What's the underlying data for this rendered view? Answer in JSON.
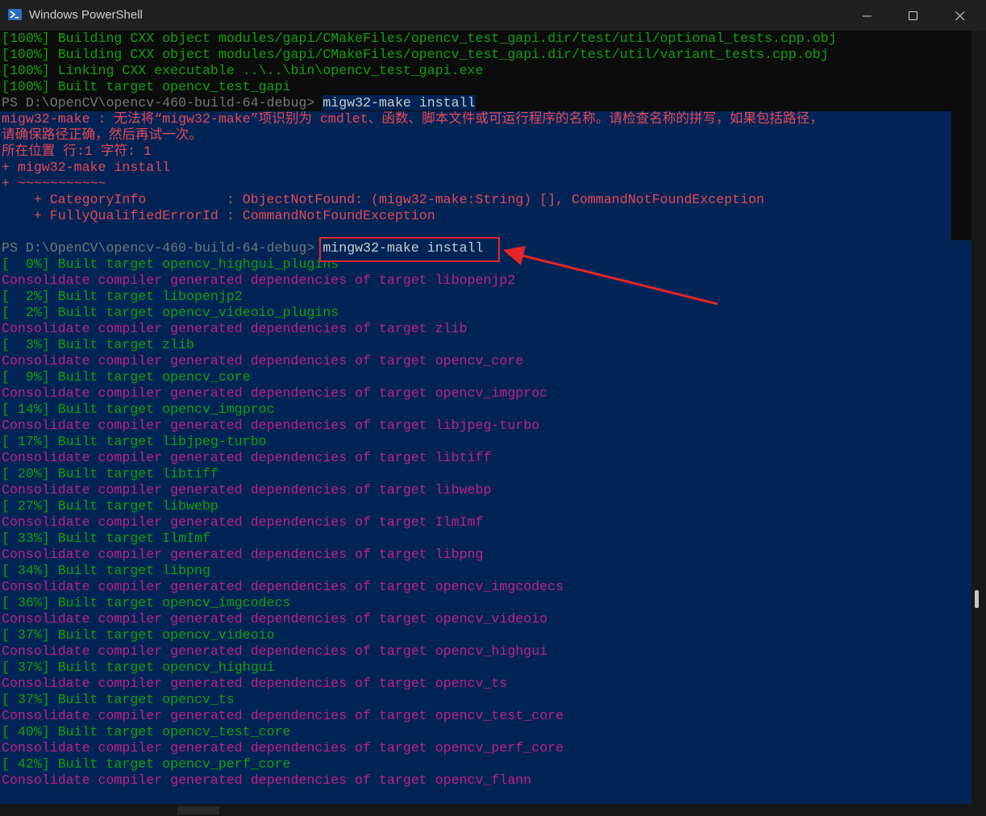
{
  "window": {
    "title": "Windows PowerShell"
  },
  "colors": {
    "selection": "#012456",
    "green": "#13a10e",
    "red": "#e74856",
    "magenta": "#c0208f",
    "annotation": "#e8262a"
  },
  "icons": {
    "app": "powershell-icon",
    "minimize": "minimize-icon",
    "maximize": "maximize-icon",
    "close": "close-icon"
  },
  "lines": [
    {
      "text": "[100%] Building CXX object modules/gapi/CMakeFiles/opencv_test_gapi.dir/test/util/optional_tests.cpp.obj"
    },
    {
      "text": "[100%] Building CXX object modules/gapi/CMakeFiles/opencv_test_gapi.dir/test/util/variant_tests.cpp.obj"
    },
    {
      "text": "[100%] Linking CXX executable ..\\..\\bin\\opencv_test_gapi.exe"
    },
    {
      "text": "[100%] Built target opencv_test_gapi"
    },
    {
      "prompt": "PS D:\\OpenCV\\opencv-460-build-64-debug> ",
      "cmd": "migw32-make install"
    },
    {
      "text": "migw32-make : 无法将“migw32-make”项识别为 cmdlet、函数、脚本文件或可运行程序的名称。请检查名称的拼写，如果包括路径，"
    },
    {
      "text": "请确保路径正确，然后再试一次。"
    },
    {
      "text": "所在位置 行:1 字符: 1"
    },
    {
      "text": "+ migw32-make install"
    },
    {
      "text": "+ ~~~~~~~~~~~"
    },
    {
      "text": "    + CategoryInfo          : ObjectNotFound: (migw32-make:String) [], CommandNotFoundException"
    },
    {
      "text": "    + FullyQualifiedErrorId : CommandNotFoundException"
    },
    {
      "text": ""
    },
    {
      "prompt": "PS D:\\OpenCV\\opencv-460-build-64-debug> ",
      "cmd": "mingw32-make install"
    },
    {
      "text": "[  0%] Built target opencv_highgui_plugins"
    },
    {
      "text": "Consolidate compiler generated dependencies of target libopenjp2"
    },
    {
      "text": "[  2%] Built target libopenjp2"
    },
    {
      "text": "[  2%] Built target opencv_videoio_plugins"
    },
    {
      "text": "Consolidate compiler generated dependencies of target zlib"
    },
    {
      "text": "[  3%] Built target zlib"
    },
    {
      "text": "Consolidate compiler generated dependencies of target opencv_core"
    },
    {
      "text": "[  9%] Built target opencv_core"
    },
    {
      "text": "Consolidate compiler generated dependencies of target opencv_imgproc"
    },
    {
      "text": "[ 14%] Built target opencv_imgproc"
    },
    {
      "text": "Consolidate compiler generated dependencies of target libjpeg-turbo"
    },
    {
      "text": "[ 17%] Built target libjpeg-turbo"
    },
    {
      "text": "Consolidate compiler generated dependencies of target libtiff"
    },
    {
      "text": "[ 20%] Built target libtiff"
    },
    {
      "text": "Consolidate compiler generated dependencies of target libwebp"
    },
    {
      "text": "[ 27%] Built target libwebp"
    },
    {
      "text": "Consolidate compiler generated dependencies of target IlmImf"
    },
    {
      "text": "[ 33%] Built target IlmImf"
    },
    {
      "text": "Consolidate compiler generated dependencies of target libpng"
    },
    {
      "text": "[ 34%] Built target libpng"
    },
    {
      "text": "Consolidate compiler generated dependencies of target opencv_imgcodecs"
    },
    {
      "text": "[ 36%] Built target opencv_imgcodecs"
    },
    {
      "text": "Consolidate compiler generated dependencies of target opencv_videoio"
    },
    {
      "text": "[ 37%] Built target opencv_videoio"
    },
    {
      "text": "Consolidate compiler generated dependencies of target opencv_highgui"
    },
    {
      "text": "[ 37%] Built target opencv_highgui"
    },
    {
      "text": "Consolidate compiler generated dependencies of target opencv_ts"
    },
    {
      "text": "[ 37%] Built target opencv_ts"
    },
    {
      "text": "Consolidate compiler generated dependencies of target opencv_test_core"
    },
    {
      "text": "[ 40%] Built target opencv_test_core"
    },
    {
      "text": "Consolidate compiler generated dependencies of target opencv_perf_core"
    },
    {
      "text": "[ 42%] Built target opencv_perf_core"
    },
    {
      "text": "Consolidate compiler generated dependencies of target opencv_flann"
    }
  ]
}
